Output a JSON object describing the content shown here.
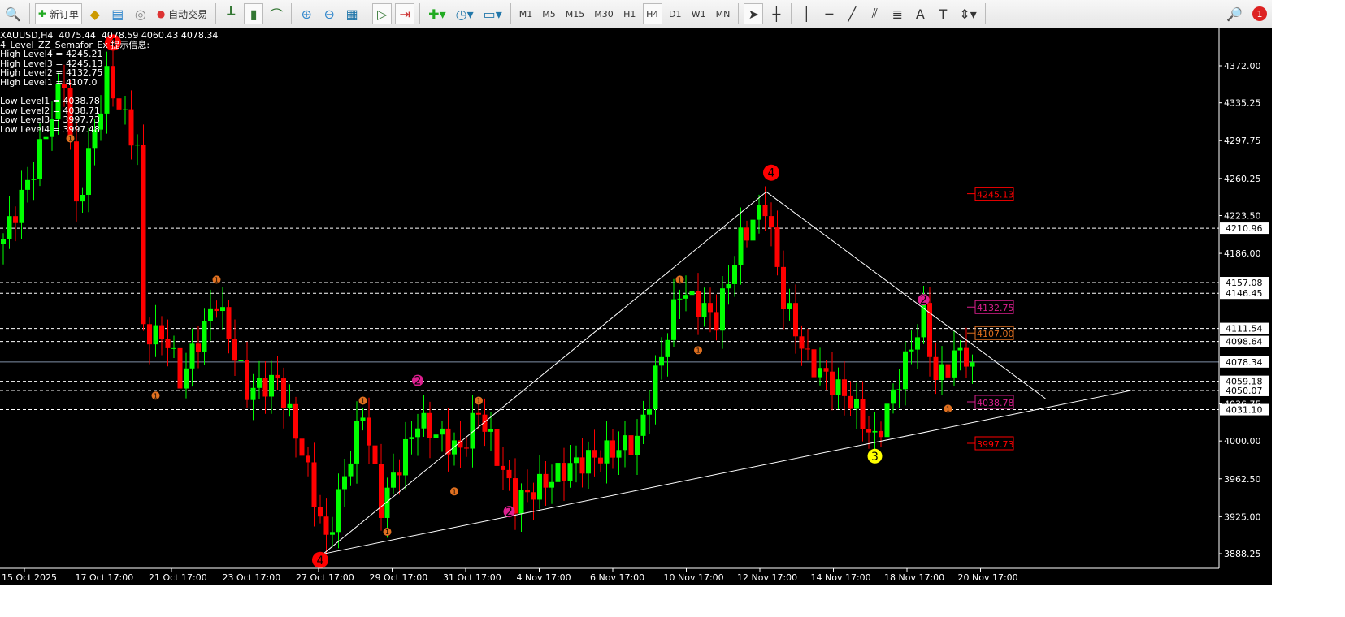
{
  "toolbar": {
    "new_order": "新订单",
    "auto_trade": "自动交易",
    "timeframes": [
      "M1",
      "M5",
      "M15",
      "M30",
      "H1",
      "H4",
      "D1",
      "W1",
      "MN"
    ],
    "active_timeframe": "H4",
    "notification_count": "1"
  },
  "info": {
    "symbol_line": "XAUUSD,H4  4075.44  4078.59 4060.43 4078.34",
    "indicator": "4_Level_ZZ_Semafor_Ex 提示信息:",
    "levels": [
      "High Level4 = 4245.21",
      "High Level3 = 4245.13",
      "High Level2 = 4132.75",
      "High Level1 = 4107.0",
      "",
      "Low Level1 = 4038.78",
      "Low Level2 = 4038.71",
      "Low Level3 = 3997.73",
      "Low Level4 = 3997.48"
    ]
  },
  "colors": {
    "bull": "#00ff00",
    "bear": "#ff0000",
    "grid": "#ffffff",
    "level4": "#ff0000",
    "level3": "#ffff00",
    "level2": "#dd1f8f",
    "level1": "#e07020"
  },
  "chart_data": {
    "type": "candlestick",
    "symbol": "XAUUSD",
    "timeframe": "H4",
    "ylim": [
      3870,
      4400
    ],
    "y_ticks": [
      "4372.00",
      "4335.25",
      "4297.75",
      "4260.25",
      "4223.50",
      "4186.00",
      "4036.75",
      "4000.00",
      "3962.50",
      "3925.00",
      "3888.25"
    ],
    "x_ticks": [
      "15 Oct 2025",
      "17 Oct 17:00",
      "21 Oct 17:00",
      "23 Oct 17:00",
      "27 Oct 17:00",
      "29 Oct 17:00",
      "31 Oct 17:00",
      "4 Nov 17:00",
      "6 Nov 17:00",
      "10 Nov 17:00",
      "12 Nov 17:00",
      "14 Nov 17:00",
      "18 Nov 17:00",
      "20 Nov 17:00"
    ],
    "close_path": [
      [
        0,
        4200
      ],
      [
        5,
        4270
      ],
      [
        10,
        4360
      ],
      [
        12,
        4230
      ],
      [
        17,
        4360
      ],
      [
        22,
        4290
      ],
      [
        23,
        4110
      ],
      [
        27,
        4100
      ],
      [
        29,
        4060
      ],
      [
        35,
        4140
      ],
      [
        40,
        4050
      ],
      [
        45,
        4060
      ],
      [
        49,
        3990
      ],
      [
        53,
        3900
      ],
      [
        59,
        4030
      ],
      [
        62,
        3935
      ],
      [
        68,
        4020
      ],
      [
        75,
        3990
      ],
      [
        78,
        4030
      ],
      [
        84,
        3940
      ],
      [
        93,
        3975
      ],
      [
        104,
        4000
      ],
      [
        111,
        4150
      ],
      [
        117,
        4120
      ],
      [
        121,
        4200
      ],
      [
        125,
        4235
      ],
      [
        128,
        4140
      ],
      [
        132,
        4080
      ],
      [
        139,
        4040
      ],
      [
        143,
        4000
      ],
      [
        151,
        4125
      ],
      [
        153,
        4060
      ],
      [
        157,
        4090
      ],
      [
        159,
        4078
      ]
    ],
    "last_price": "4078.34",
    "h_levels": [
      "4210.96",
      "4157.08",
      "4146.45",
      "4111.54",
      "4098.64",
      "4059.18",
      "4050.07",
      "4031.10"
    ],
    "level_boxes": [
      {
        "label": "4245.13",
        "price": 4245.13,
        "level": 4
      },
      {
        "label": "4132.75",
        "price": 4132.75,
        "level": 2
      },
      {
        "label": "4107.00",
        "price": 4107,
        "level": 1
      },
      {
        "label": "4038.78",
        "price": 4038.78,
        "level": 2
      },
      {
        "label": "3997.73",
        "price": 3997.73,
        "level": 4
      }
    ],
    "semafor": [
      {
        "i": 11,
        "p": 4300,
        "n": "1"
      },
      {
        "i": 18,
        "p": 4395,
        "n": "4"
      },
      {
        "i": 25,
        "p": 4045,
        "n": "1"
      },
      {
        "i": 35,
        "p": 4160,
        "n": "1"
      },
      {
        "i": 52,
        "p": 3882,
        "n": "4"
      },
      {
        "i": 59,
        "p": 4040,
        "n": "1"
      },
      {
        "i": 63,
        "p": 3910,
        "n": "1"
      },
      {
        "i": 68,
        "p": 4060,
        "n": "2"
      },
      {
        "i": 74,
        "p": 3950,
        "n": "1"
      },
      {
        "i": 78,
        "p": 4040,
        "n": "1"
      },
      {
        "i": 83,
        "p": 3930,
        "n": "2"
      },
      {
        "i": 111,
        "p": 4160,
        "n": "1"
      },
      {
        "i": 114,
        "p": 4090,
        "n": "1"
      },
      {
        "i": 126,
        "p": 4266,
        "n": "4"
      },
      {
        "i": 143,
        "p": 3985,
        "n": "3"
      },
      {
        "i": 151,
        "p": 4140,
        "n": "2"
      },
      {
        "i": 155,
        "p": 4032,
        "n": "1"
      }
    ]
  }
}
